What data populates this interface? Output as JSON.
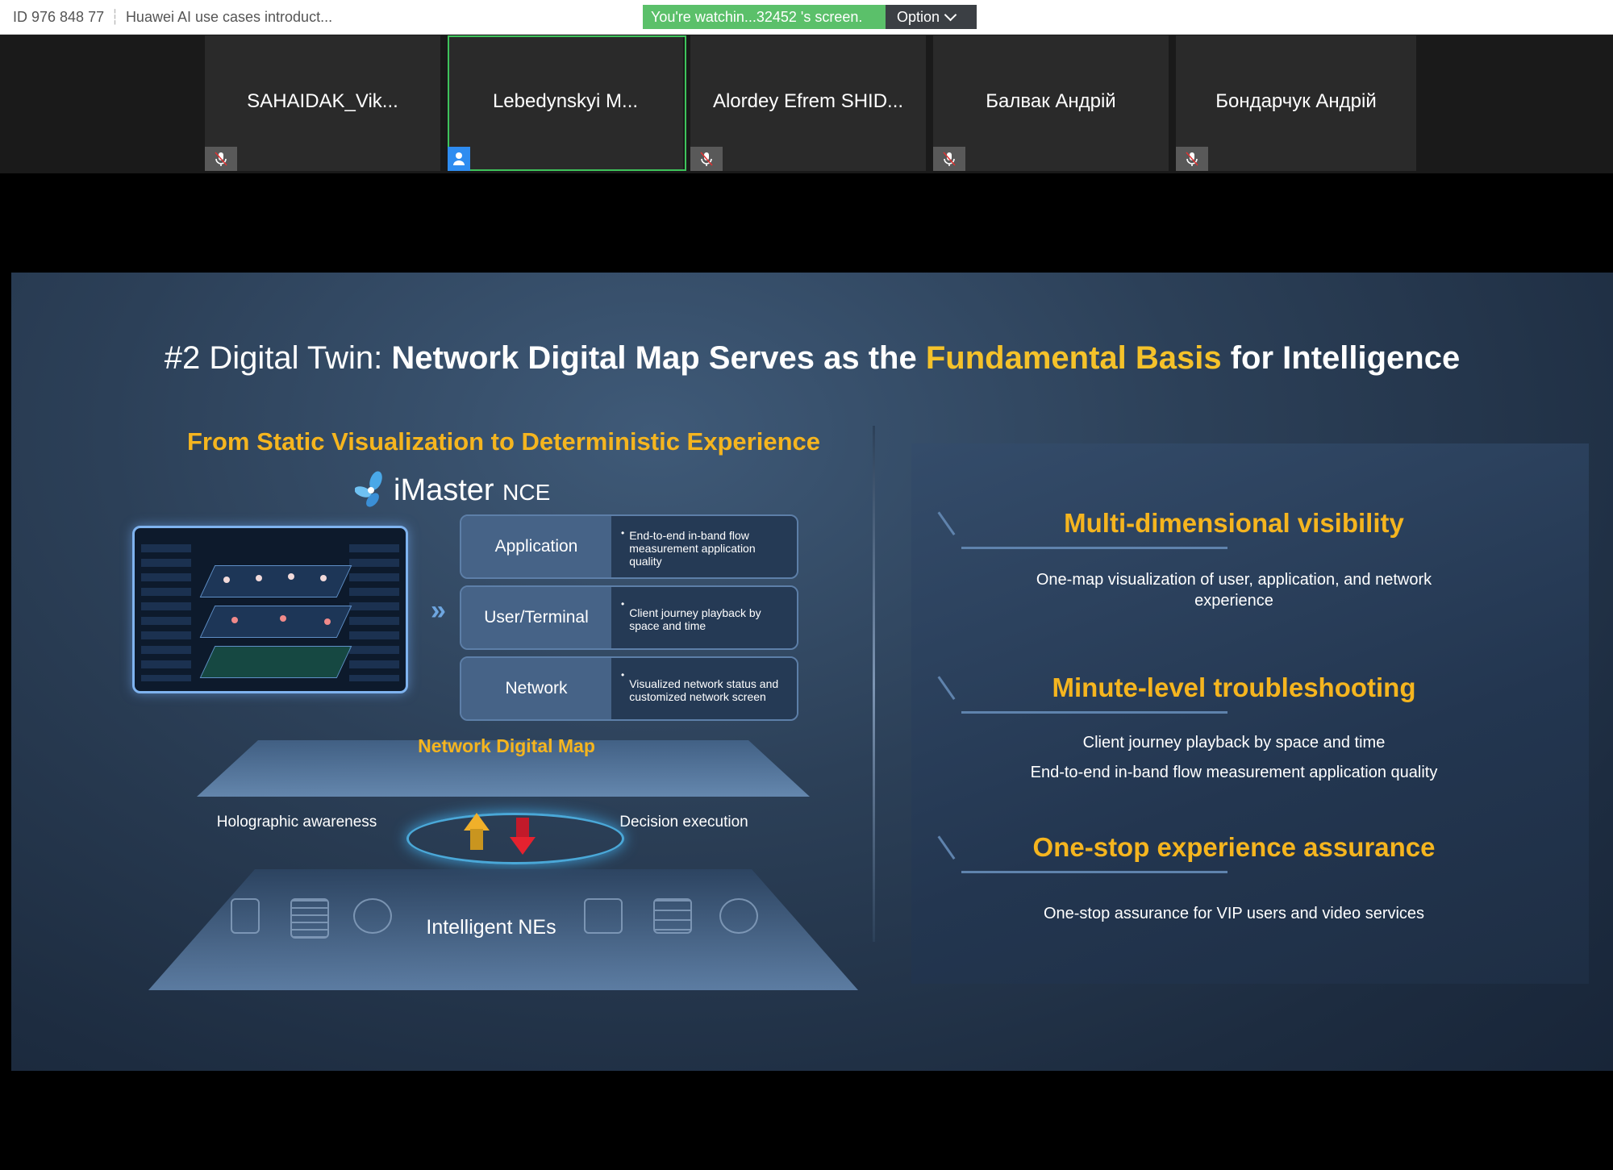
{
  "topbar": {
    "meeting_id": "ID 976 848 77",
    "meeting_title": "Huawei AI use cases introduct...",
    "watching": "You're watchin...32452 's screen.",
    "option": "Option"
  },
  "participants": [
    {
      "name": "SAHAIDAK_Vik...",
      "mic": "muted"
    },
    {
      "name": "Lebedynskyi M...",
      "mic": "active-speaker"
    },
    {
      "name": "Alordey Efrem SHID...",
      "mic": "muted"
    },
    {
      "name": "Балвак Андрій",
      "mic": "muted"
    },
    {
      "name": "Бондарчук Андрій",
      "mic": "muted"
    }
  ],
  "slide": {
    "title_prefix": "#2 Digital Twin: ",
    "title_bold": "Network Digital Map Serves as the ",
    "title_gold": "Fundamental Basis",
    "title_suffix": " for Intelligence",
    "subtitle": "From Static Visualization to Deterministic Experience",
    "brand_main": "iMaster",
    "brand_suffix": "NCE",
    "layers": [
      {
        "label": "Application",
        "desc": "End-to-end in-band flow measurement application quality"
      },
      {
        "label": "User/Terminal",
        "desc": "Client journey playback by space and time"
      },
      {
        "label": "Network",
        "desc": "Visualized network status and customized network screen"
      }
    ],
    "ndm_label": "Network Digital Map",
    "holographic": "Holographic awareness",
    "decision": "Decision execution",
    "ne_label": "Intelligent NEs",
    "features": [
      {
        "title": "Multi-dimensional visibility",
        "desc": [
          "One-map visualization of user, application, and network",
          "experience"
        ]
      },
      {
        "title": "Minute-level troubleshooting",
        "desc": [
          "Client journey playback by space and time",
          "End-to-end in-band flow measurement application quality"
        ]
      },
      {
        "title": "One-stop experience assurance",
        "desc": [
          "One-stop assurance for VIP users and  video services"
        ]
      }
    ]
  },
  "colors": {
    "accent_gold": "#f5b51f",
    "active_green": "#3ec35b",
    "watch_green": "#5bc06a"
  }
}
